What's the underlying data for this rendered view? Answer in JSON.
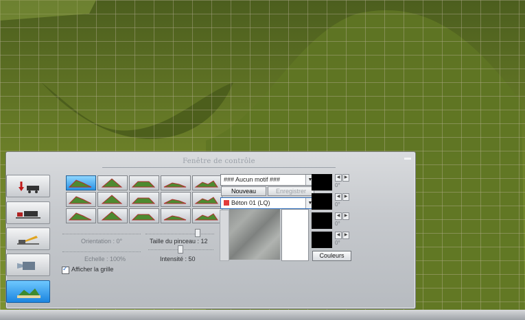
{
  "window": {
    "title": "Fenêtre de contrôle"
  },
  "mode_buttons": [
    {
      "icon": "terrain-raise-icon"
    },
    {
      "icon": "track-icon"
    },
    {
      "icon": "crane-icon"
    },
    {
      "icon": "camera-icon"
    },
    {
      "icon": "landscape-paint-icon"
    }
  ],
  "tools": [
    {
      "icon": "terrain-hill-icon"
    },
    {
      "icon": "terrain-peak-icon"
    },
    {
      "icon": "terrain-plateau-icon"
    },
    {
      "icon": "water-drop-icon"
    },
    {
      "icon": "terrain-flag-icon"
    },
    {
      "icon": "vehicle-icon"
    },
    {
      "icon": "sun-terrain-icon"
    },
    {
      "icon": "stretch-terrain-icon"
    },
    {
      "icon": "cross-terrain-icon"
    },
    {
      "icon": "donut-terrain-icon"
    },
    {
      "icon": "spiral-icon"
    },
    {
      "icon": "lock-icon"
    },
    {
      "icon": "ring-terrain-icon"
    },
    {
      "icon": "stripe-terrain-icon"
    },
    {
      "icon": "flatten-terrain-icon"
    }
  ],
  "controls": {
    "orientation": "Orientation : 0°",
    "echelle": "Echelle : 100%",
    "taille": "Taille du pinceau : 12",
    "intensite": "Intensité : 50",
    "afficher_grille": "Afficher la grille",
    "grid_checked": true
  },
  "texture": {
    "pattern_value": "### Aucun motif ###",
    "nouveau": "Nouveau",
    "enregistrer": "Enregistrer",
    "material_value": "Béton 01 (LQ)",
    "material_color": "#e23b3b"
  },
  "colors": {
    "degree_labels": [
      "0°",
      "0°",
      "0°",
      "0°"
    ],
    "couleurs_button": "Couleurs"
  }
}
